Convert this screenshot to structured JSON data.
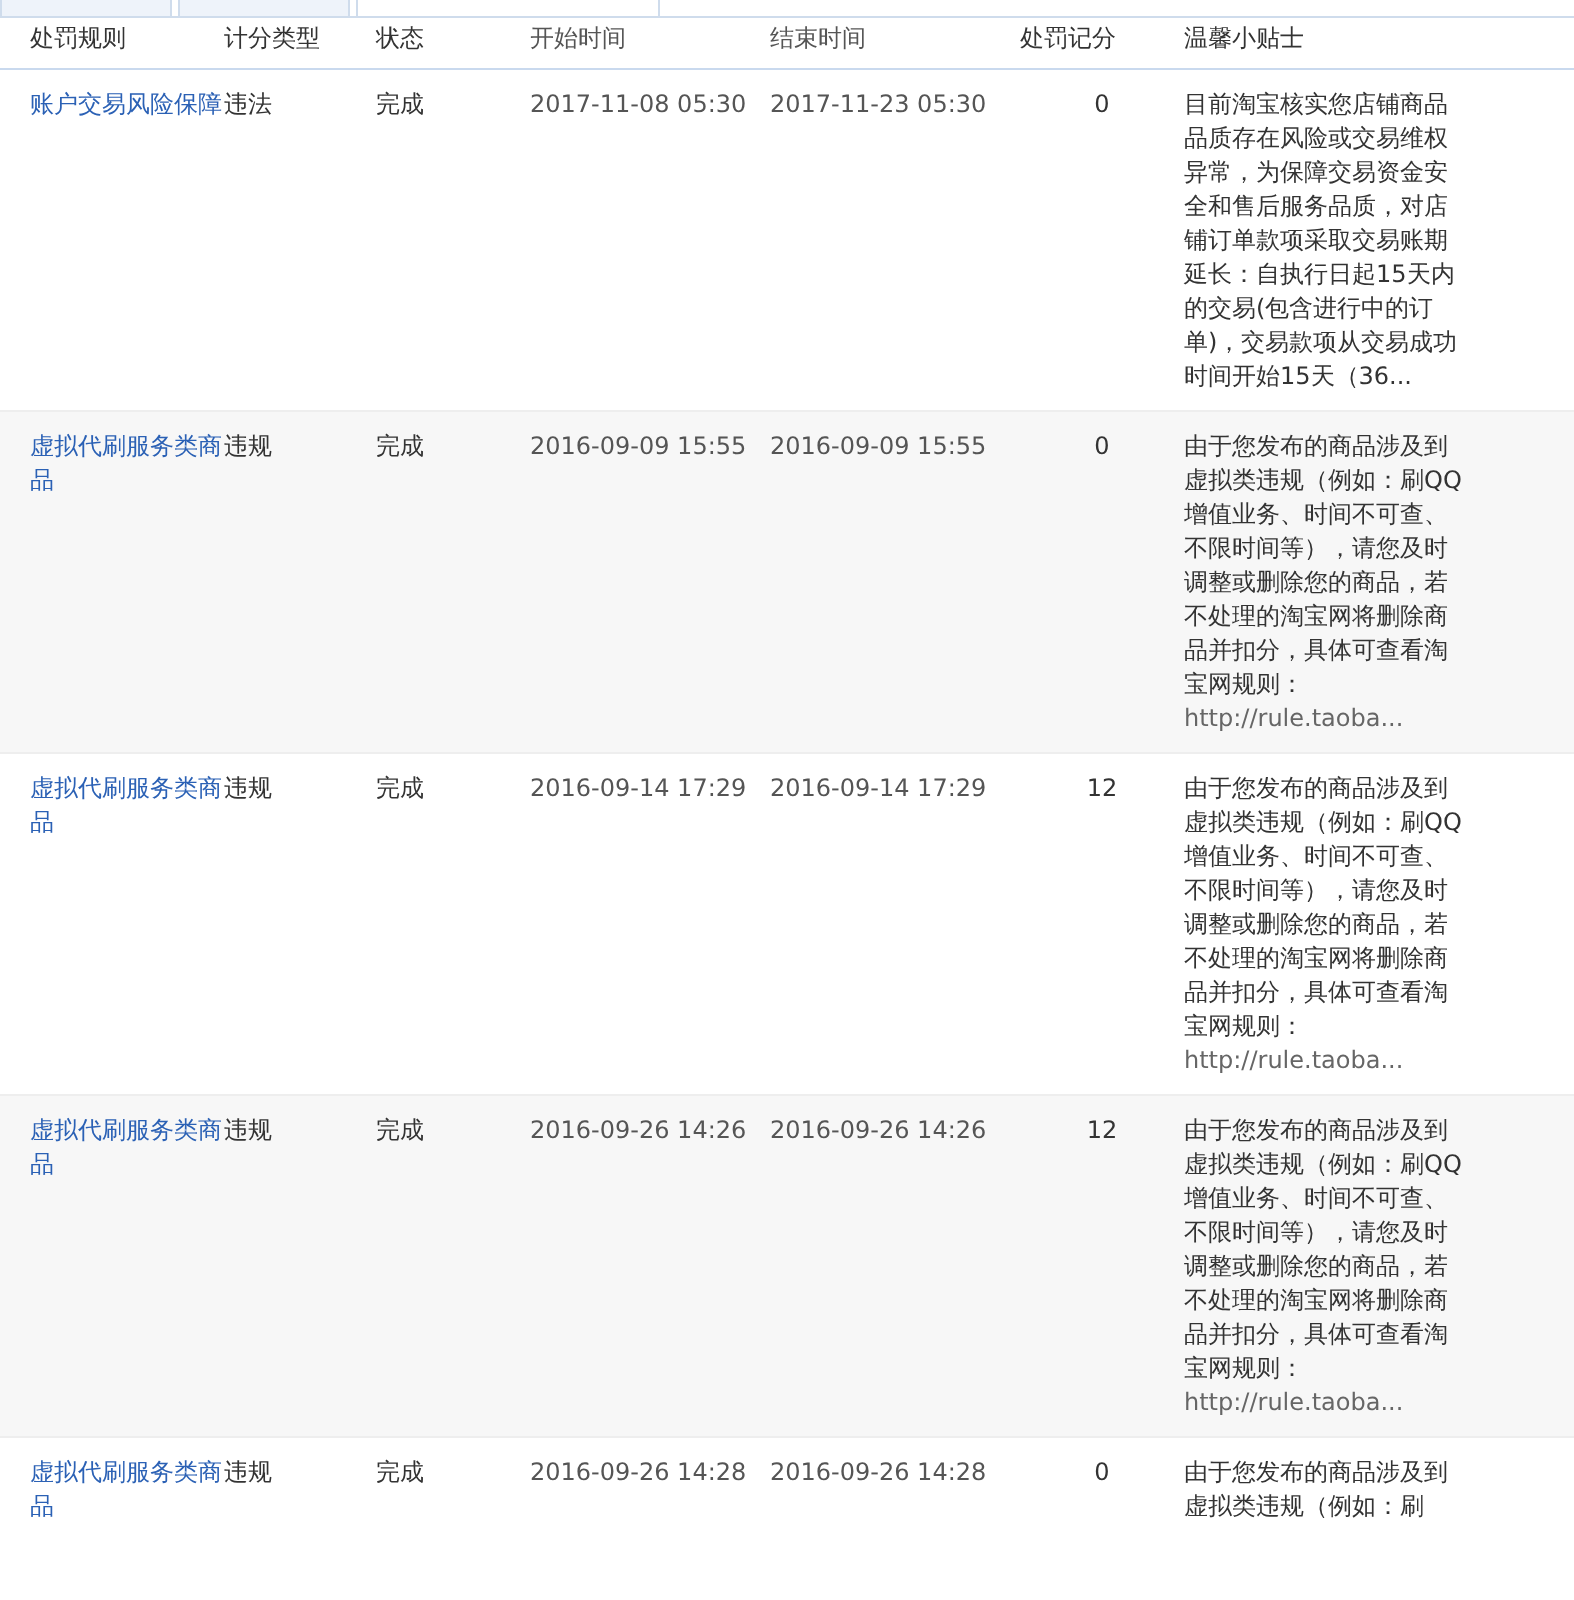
{
  "tabs": [
    {
      "selected": false
    },
    {
      "selected": false
    },
    {
      "selected": true
    }
  ],
  "table": {
    "columns": [
      "处罚规则",
      "计分类型",
      "状态",
      "开始时间",
      "结束时间",
      "处罚记分",
      "温馨小贴士"
    ],
    "rows": [
      {
        "rule": "账户交易风险保障",
        "type": "违法",
        "status": "完成",
        "start": "2017-11-08 05:30",
        "end": "2017-11-23 05:30",
        "points": "0",
        "tip": "目前淘宝核实您店铺商品品质存在风险或交易维权异常，为保障交易资金安全和售后服务品质，对店铺订单款项采取交易账期延长：自执行日起15天内的交易(包含进行中的订单)，交易款项从交易成功时间开始15天（36...",
        "link": ""
      },
      {
        "rule": "虚拟代刷服务类商品",
        "type": "违规",
        "status": "完成",
        "start": "2016-09-09 15:55",
        "end": "2016-09-09 15:55",
        "points": "0",
        "tip": "由于您发布的商品涉及到虚拟类违规（例如：刷QQ增值业务、时间不可查、不限时间等），请您及时调整或删除您的商品，若不处理的淘宝网将删除商品并扣分，具体可查看淘宝网规则：",
        "link": "http://rule.taoba..."
      },
      {
        "rule": "虚拟代刷服务类商品",
        "type": "违规",
        "status": "完成",
        "start": "2016-09-14 17:29",
        "end": "2016-09-14 17:29",
        "points": "12",
        "tip": "由于您发布的商品涉及到虚拟类违规（例如：刷QQ增值业务、时间不可查、不限时间等），请您及时调整或删除您的商品，若不处理的淘宝网将删除商品并扣分，具体可查看淘宝网规则：",
        "link": "http://rule.taoba..."
      },
      {
        "rule": "虚拟代刷服务类商品",
        "type": "违规",
        "status": "完成",
        "start": "2016-09-26 14:26",
        "end": "2016-09-26 14:26",
        "points": "12",
        "tip": "由于您发布的商品涉及到虚拟类违规（例如：刷QQ增值业务、时间不可查、不限时间等），请您及时调整或删除您的商品，若不处理的淘宝网将删除商品并扣分，具体可查看淘宝网规则：",
        "link": "http://rule.taoba..."
      },
      {
        "rule": "虚拟代刷服务类商品",
        "type": "违规",
        "status": "完成",
        "start": "2016-09-26 14:28",
        "end": "2016-09-26 14:28",
        "points": "0",
        "tip": "由于您发布的商品涉及到虚拟类违规（例如：刷",
        "link": ""
      }
    ]
  }
}
